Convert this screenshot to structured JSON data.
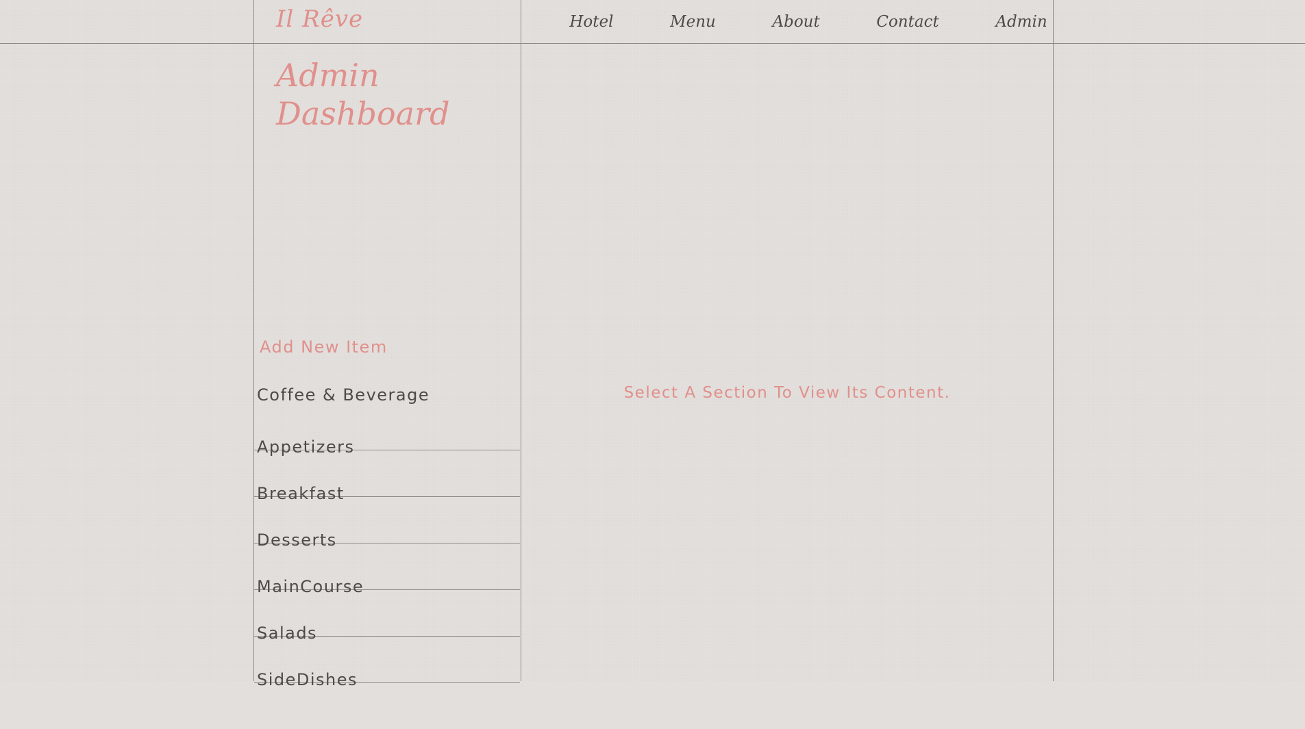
{
  "header": {
    "brand": "Il Rêve",
    "nav": [
      {
        "label": "Hotel"
      },
      {
        "label": "Menu"
      },
      {
        "label": "About"
      },
      {
        "label": "Contact"
      },
      {
        "label": "Admin"
      }
    ]
  },
  "sidebar": {
    "title": "Admin Dashboard",
    "add_item_label": "Add New Item",
    "categories": [
      {
        "label": "Coffee & Beverage"
      },
      {
        "label": "Appetizers"
      },
      {
        "label": "Breakfast"
      },
      {
        "label": "Desserts"
      },
      {
        "label": "MainCourse"
      },
      {
        "label": "Salads"
      },
      {
        "label": "SideDishes"
      }
    ]
  },
  "main": {
    "placeholder": "Select A Section To View Its Content."
  },
  "colors": {
    "background": "#e3dfdc",
    "accent": "#e0908c",
    "text": "#4f4a47",
    "lines": "#8f8a86"
  }
}
